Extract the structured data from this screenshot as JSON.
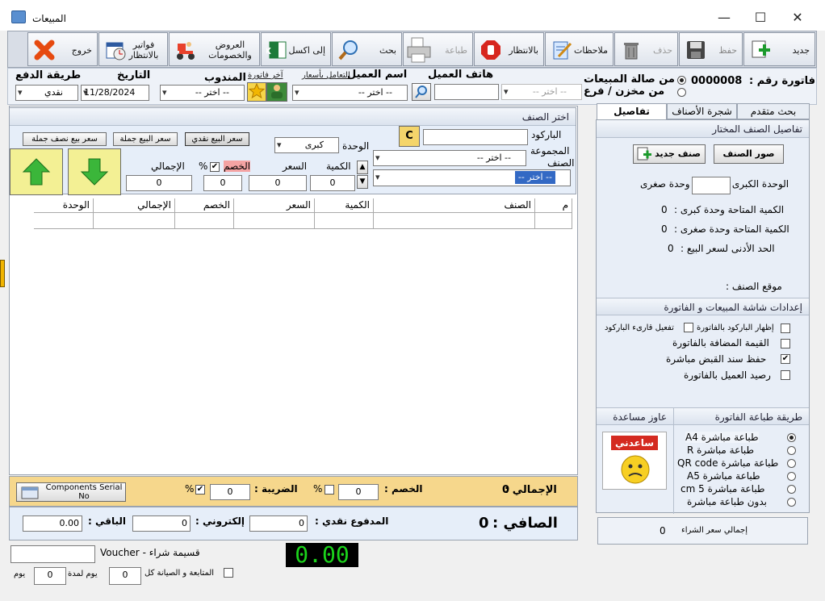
{
  "window": {
    "title": "المبيعات",
    "minimize": "—",
    "maximize": "☐",
    "close": "✕"
  },
  "toolbar": {
    "new": "جديد",
    "save": "حفظ",
    "delete": "حذف",
    "notes": "ملاحظات",
    "pending": "بالانتظار",
    "print": "طباعة",
    "search": "بحث",
    "excel": "إلى اكسل",
    "offers": "العروض والخصومات",
    "pending_invoices": "فواتير بالانتظار",
    "exit": "خروج"
  },
  "header": {
    "invoice_no_label": "فاتورة رقم :",
    "invoice_no": "0000008",
    "from_hall": "من صالة المبيعات",
    "from_store": "من مخزن / فرع",
    "branch_placeholder": "-- اختر --",
    "customer_phone_label": "هاتف العميل",
    "customer_name_label": "اسم العميل",
    "customer_placeholder": "-- اختر --",
    "link_prices": "التعامل بأسعار",
    "link_last_invoice": "آخر فاتورة",
    "rep_label": "المندوب",
    "rep_placeholder": "-- اختر --",
    "date_label": "التاريخ",
    "date_value": "11/28/2024",
    "payment_label": "طريقة الدفع",
    "payment_value": "نقدي"
  },
  "item_panel": {
    "title": "اختر الصنف",
    "barcode_label": "الباركود",
    "c_button": "C",
    "group_label": "المجموعة",
    "group_placeholder": "-- اختر --",
    "item_label": "الصنف",
    "item_placeholder": "-- اختر --",
    "unit_label": "الوحدة",
    "unit_value": "كبرى",
    "qty_label": "الكمية",
    "qty_value": "0",
    "price_label": "السعر",
    "price_value": "0",
    "discount_label": "الخصم",
    "discount_value": "0",
    "percent": "%",
    "total_label": "الإجمالي",
    "total_value": "0",
    "price_cash": "سعر البيع نقدي",
    "price_wholesale": "سعر البيع جملة",
    "price_half_wholesale": "سعر بيع نصف جملة"
  },
  "grid": {
    "columns": [
      "م",
      "الصنف",
      "الكمية",
      "السعر",
      "الخصم",
      "الإجمالي",
      "الوحدة"
    ]
  },
  "right_panel": {
    "tabs": [
      "بحث متقدم",
      "شجرة الأصناف",
      "تفاصيل"
    ],
    "selected_item_title": "تفاصيل الصنف المختار",
    "item_images_btn": "صور الصنف",
    "new_item_btn": "صنف جديد",
    "big_unit_label": "الوحدة الكبرى =",
    "small_unit_label": "وحدة صغرى",
    "avail_big": "الكمية المتاحة وحدة كبرى :",
    "avail_big_value": "0",
    "avail_small": "الكمية المتاحة وحدة صغرى :",
    "avail_small_value": "0",
    "min_price": "الحد الأدنى لسعر البيع :",
    "min_price_value": "0",
    "location": "موقع الصنف :",
    "settings_title": "إعدادات شاشة المبيعات و الفاتورة",
    "show_barcode": "إظهار الباركود بالفاتورة",
    "enable_reader": "تفعيل قارىء الباركود",
    "vat": "القيمة المضافة بالفاتورة",
    "save_receipt": "حفظ سند القبض مباشرة",
    "customer_balance": "رصيد العميل بالفاتورة",
    "print_method_title": "طريقة طباعة الفاتورة",
    "help_title": "عاوز مساعدة",
    "help_badge": "ساعدني",
    "print_options": [
      "طباعة مباشرة A4",
      "طباعة مباشرة R",
      "طباعة مباشرة QR code",
      "طباعة مباشرة A5",
      "طباعة مباشرة 5 cm",
      "بدون طباعة مباشرة"
    ],
    "purchase_total_label": "إجمالي سعر الشراء",
    "purchase_total_value": "0"
  },
  "totals": {
    "total_label": "الإجمالي :",
    "total_value": "0",
    "discount_label": "الخصم :",
    "discount_value": "0",
    "percent": "%",
    "tax_label": "الضريبة :",
    "tax_value": "0",
    "serial_btn": "Components Serial No",
    "net_label": "الصافي :",
    "net_value": "0",
    "cash_paid_label": "المدفوع نقدي :",
    "cash_paid_value": "0",
    "electronic_label": "إلكتروني :",
    "electronic_value": "0",
    "remaining_label": "الباقي :",
    "remaining_value": "0.00"
  },
  "footer": {
    "voucher_label": "قسيمة شراء - Voucher",
    "display_value": "0.00",
    "maintenance_label": "المتابعة و الصيانة كل",
    "days_label": "يوم لمدة",
    "days_value": "0",
    "day_label": "يوم",
    "period_value": "0"
  }
}
